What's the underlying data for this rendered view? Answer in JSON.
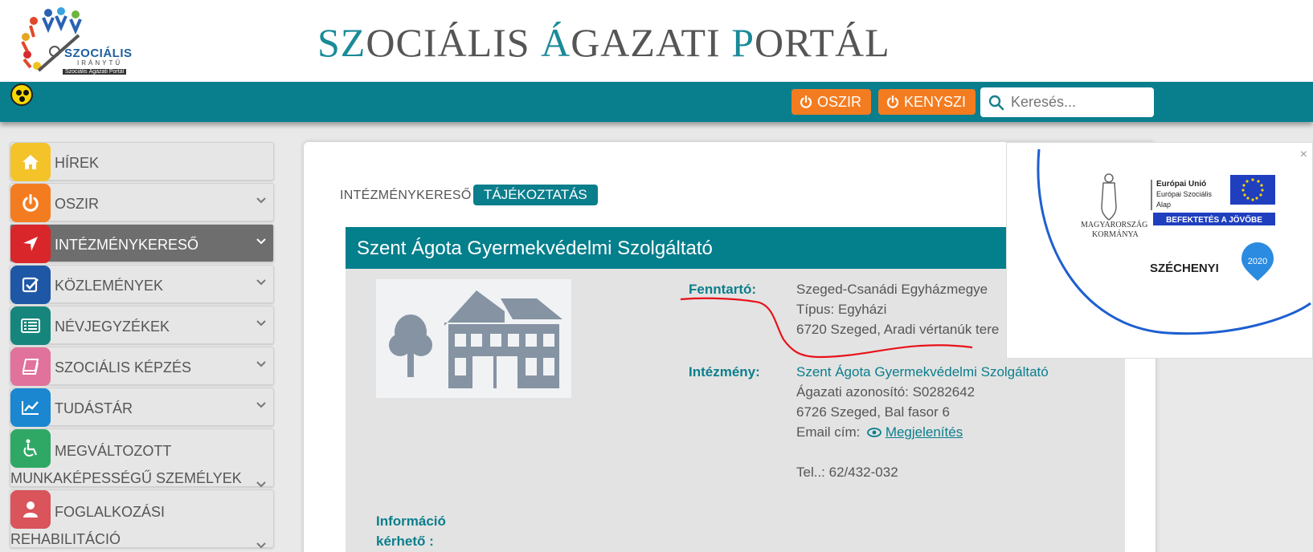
{
  "header": {
    "logo": {
      "line1": "SZOCIÁLIS",
      "line2": "IRÁNYTŰ",
      "line3": "Szociális Ágazati Portál"
    },
    "title_parts": [
      {
        "text": "SZ",
        "hl": true
      },
      {
        "text": "OCIÁLIS ",
        "hl": false
      },
      {
        "text": "Á",
        "hl": true
      },
      {
        "text": "GAZATI ",
        "hl": false
      },
      {
        "text": "P",
        "hl": true
      },
      {
        "text": "ORTÁL",
        "hl": false
      }
    ]
  },
  "topbar": {
    "oszir_label": "OSZIR",
    "kenyszi_label": "KENYSZI",
    "search_placeholder": "Keresés...",
    "accessibility_icon": "low-vision-icon"
  },
  "sidebar": {
    "items": [
      {
        "label": "HÍREK",
        "icon": "home-icon",
        "color": "#f4c32a",
        "chevron": false
      },
      {
        "label": "OSZIR",
        "icon": "power-icon",
        "color": "#f47c20",
        "chevron": true
      },
      {
        "label": "INTÉZMÉNYKERESŐ",
        "icon": "location-arrow-icon",
        "color": "#d9262b",
        "chevron": true,
        "active": true
      },
      {
        "label": "KÖZLEMÉNYEK",
        "icon": "checkbox-icon",
        "color": "#1d57a5",
        "chevron": true
      },
      {
        "label": "NÉVJEGYZÉKEK",
        "icon": "list-icon",
        "color": "#16857c",
        "chevron": true
      },
      {
        "label": "SZOCIÁLIS KÉPZÉS",
        "icon": "book-icon",
        "color": "#e0729b",
        "chevron": true
      },
      {
        "label": "TUDÁSTÁR",
        "icon": "chart-line-icon",
        "color": "#1a87d0",
        "chevron": true
      },
      {
        "label": "MEGVÁLTOZOTT",
        "label2": "MUNKAKÉPESSÉGŰ SZEMÉLYEK",
        "icon": "wheelchair-icon",
        "color": "#2fa865",
        "chevron": true
      },
      {
        "label": "FOGLALKOZÁSI",
        "label2": "REHABILITÁCIÓ",
        "icon": "user-icon",
        "color": "#d9545b",
        "chevron": true
      }
    ]
  },
  "breadcrumb": {
    "item1": "INTÉZMÉNYKERESŐ",
    "item2": "TÁJÉKOZTATÁS"
  },
  "institution": {
    "name": "Szent Ágota Gyermekvédelmi Szolgáltató",
    "fenntarto_label": "Fenntartó:",
    "fenntarto_name": "Szeged-Csanádi Egyházmegye",
    "fenntarto_type": "Típus: Egyházi",
    "fenntarto_address": "6720 Szeged, Aradi vértanúk tere",
    "intezmeny_label": "Intézmény:",
    "intezmeny_name": "Szent Ágota Gyermekvédelmi Szolgáltató",
    "agazati_id": "Ágazati azonosító: S0282642",
    "address": "6726 Szeged, Bal fasor 6",
    "email_prefix": "Email cím:",
    "email_link": "Megjelenítés",
    "phone": "Tel..: 62/432-032",
    "info_label_1": "Információ",
    "info_label_2": "kérhető :"
  },
  "eu_popup": {
    "gov_line1": "MAGYARORSZÁG",
    "gov_line2": "KORMÁNYA",
    "eu_line1": "Európai Unió",
    "eu_line2": "Európai Szociális",
    "eu_line3": "Alap",
    "invest": "BEFEKTETÉS A JÖVŐBE",
    "szechenyi": "SZÉCHENYI",
    "year": "2020",
    "close": "×"
  }
}
